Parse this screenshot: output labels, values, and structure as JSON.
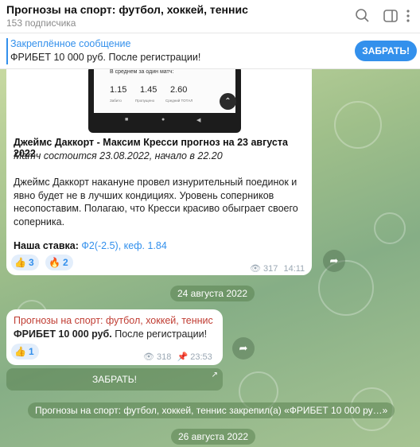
{
  "header": {
    "title": "Прогнозы на спорт: футбол, хоккей, теннис",
    "subtitle": "153 подписчика",
    "icons": [
      "search-icon",
      "sidebar-toggle-icon",
      "more-vertical-icon"
    ]
  },
  "pinned": {
    "title": "Закреплённое сообщение",
    "text": "ФРИБЕТ 10 000 руб. После регистрации!",
    "button": "ЗАБРАТЬ!"
  },
  "screenshot_inner": {
    "heading": "В среднем за один матч:",
    "values": [
      "1.15",
      "1.45",
      "2.60"
    ],
    "labels": [
      "Забито",
      "Пропущено",
      "Средний ТОТАЛ"
    ]
  },
  "message1": {
    "title": "Джеймс Даккорт - Максим Кресси прогноз на 23 августа 2022",
    "subtitle": "Матч состоится 23.08.2022, начало в 22.20",
    "body": "Джеймс Даккорт накануне провел изнурительный поединок и явно будет не в лучших кондициях. Уровень соперников несопоставим. Полагаю, что Кресси красиво обыграет своего соперника.",
    "bet_label": "Наша ставка:",
    "bet_value": "Ф2(-2.5), кеф. 1.84",
    "reactions": [
      {
        "emoji": "👍",
        "count": "3"
      },
      {
        "emoji": "🔥",
        "count": "2"
      }
    ],
    "views": "317",
    "time": "14:11"
  },
  "date1": "24 августа 2022",
  "message2": {
    "author": "Прогнозы на спорт: футбол, хоккей, теннис",
    "text_bold": "ФРИБЕТ 10 000 руб.",
    "text_rest": " После регистрации!",
    "reactions": [
      {
        "emoji": "👍",
        "count": "1"
      }
    ],
    "views": "318",
    "time": "23:53",
    "button": "ЗАБРАТЬ!"
  },
  "service_message": "Прогнозы на спорт: футбол, хоккей, теннис закрепил(а) «ФРИБЕТ 10 000 ру…»",
  "date2": "26 августа 2022",
  "colors": {
    "accent": "#3390ec",
    "author": "#c03d33"
  }
}
